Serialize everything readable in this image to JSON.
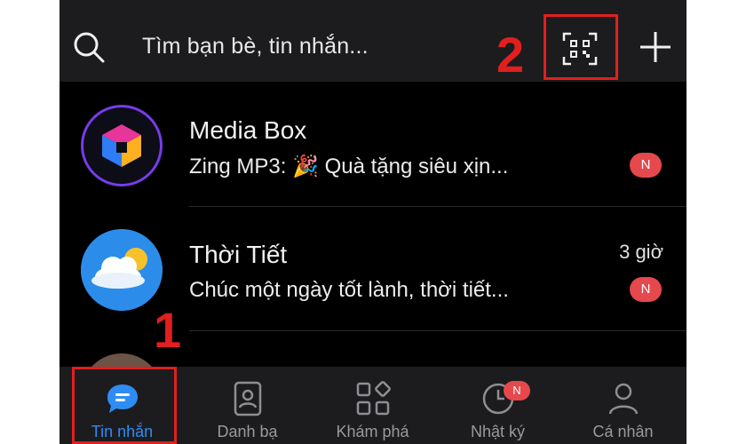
{
  "search": {
    "placeholder": "Tìm bạn bè, tin nhắn..."
  },
  "annotations": {
    "label_1": "1",
    "label_2": "2"
  },
  "chats": [
    {
      "name": "Media Box",
      "message": "Zing MP3: 🎉 Quà tặng siêu xịn...",
      "time": "",
      "badge": "N",
      "avatar_icon": "cube-logo-icon"
    },
    {
      "name": "Thời Tiết",
      "message": "Chúc một ngày tốt lành, thời tiết...",
      "time": "3 giờ",
      "badge": "N",
      "avatar_icon": "weather-cloud-sun-icon"
    }
  ],
  "bottom_nav": [
    {
      "label": "Tin nhắn",
      "icon": "chat-bubble-icon",
      "active": true
    },
    {
      "label": "Danh bạ",
      "icon": "contacts-icon",
      "active": false
    },
    {
      "label": "Khám phá",
      "icon": "grid-discover-icon",
      "active": false
    },
    {
      "label": "Nhật ký",
      "icon": "clock-icon",
      "active": false,
      "badge": "N"
    },
    {
      "label": "Cá nhân",
      "icon": "person-icon",
      "active": false
    }
  ],
  "colors": {
    "accent": "#2f8cf5",
    "highlight": "#e11f1f",
    "badge": "#e5484d",
    "background": "#000000",
    "bar": "#1c1c1e"
  }
}
